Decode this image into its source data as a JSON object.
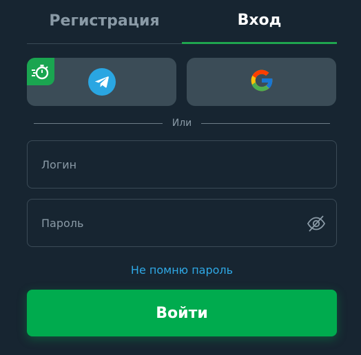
{
  "tabs": {
    "register_label": "Регистрация",
    "login_label": "Вход",
    "active": "login"
  },
  "social": {
    "telegram_icon": "telegram-icon",
    "google_icon": "google-icon",
    "badge_icon": "stopwatch-icon"
  },
  "divider": {
    "label": "Или"
  },
  "form": {
    "login_placeholder": "Логин",
    "login_value": "",
    "password_placeholder": "Пароль",
    "password_value": "",
    "password_toggle_icon": "eye-off-icon"
  },
  "forgot_label": "Не помню пароль",
  "submit_label": "Войти",
  "colors": {
    "background": "#172531",
    "accent_green": "#00ab4e",
    "link_blue": "#2fa9e6",
    "social_button_bg": "#3b4c57",
    "telegram_blue": "#2aa6e2"
  }
}
